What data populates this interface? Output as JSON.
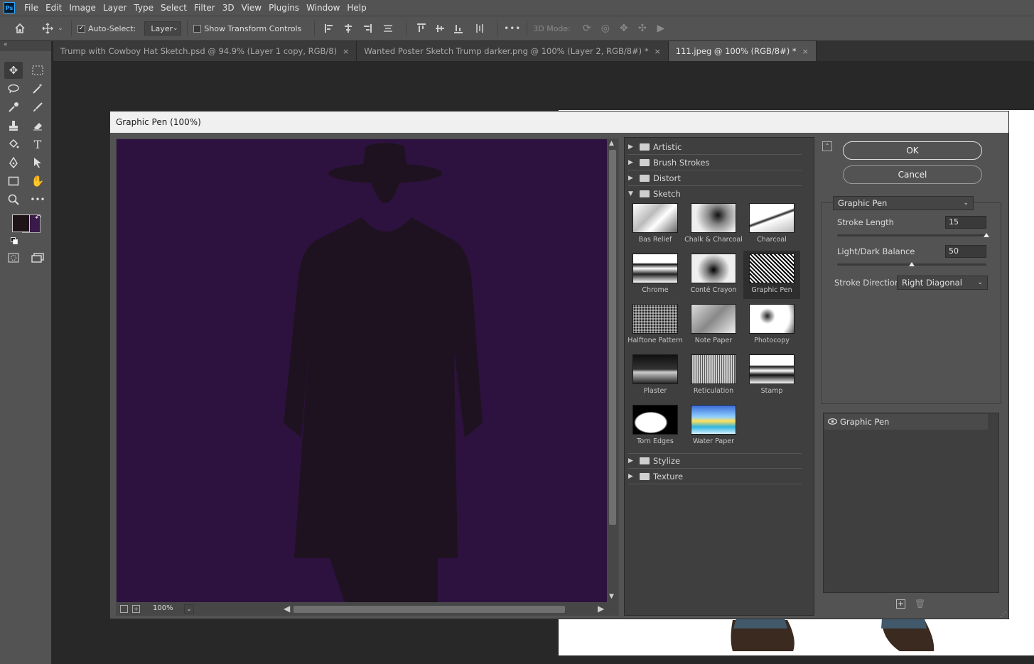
{
  "menu": [
    "File",
    "Edit",
    "Image",
    "Layer",
    "Type",
    "Select",
    "Filter",
    "3D",
    "View",
    "Plugins",
    "Window",
    "Help"
  ],
  "app_logo": "Ps",
  "options_bar": {
    "auto_select_label": "Auto-Select:",
    "auto_select_value": "Layer",
    "show_transform_label": "Show Transform Controls",
    "mode_3d_label": "3D Mode:",
    "more_label": "•••"
  },
  "tabs": [
    {
      "label": "Trump with Cowboy Hat Sketch.psd @ 94.9% (Layer 1 copy, RGB/8)",
      "active": false
    },
    {
      "label": "Wanted Poster Sketch Trump darker.png @ 100% (Layer 2, RGB/8#) *",
      "active": false
    },
    {
      "label": "111.jpeg @ 100% (RGB/8#) *",
      "active": true
    }
  ],
  "toolbar_collapse": "«",
  "colors": {
    "foreground": "#1e1418",
    "background": "#3a1a4a",
    "preview_bg": "#2d1240",
    "silhouette": "#1f1220"
  },
  "dialog": {
    "title": "Graphic Pen (100%)",
    "zoom": "100%",
    "ok_label": "OK",
    "cancel_label": "Cancel",
    "filter_select": "Graphic Pen",
    "stroke_length_label": "Stroke Length",
    "stroke_length_value": "15",
    "stroke_length_fraction": 1.0,
    "light_dark_label": "Light/Dark Balance",
    "light_dark_value": "50",
    "light_dark_fraction": 0.5,
    "stroke_direction_label": "Stroke Direction:",
    "stroke_direction_value": "Right Diagonal",
    "effect_layer": "Graphic Pen"
  },
  "gallery": {
    "categories_top": [
      "Artistic",
      "Brush Strokes",
      "Distort"
    ],
    "open_category": "Sketch",
    "categories_bottom": [
      "Stylize",
      "Texture"
    ],
    "filters": [
      {
        "label": "Bas Relief",
        "selected": false
      },
      {
        "label": "Chalk & Charcoal",
        "selected": false
      },
      {
        "label": "Charcoal",
        "selected": false
      },
      {
        "label": "Chrome",
        "selected": false
      },
      {
        "label": "Conté Crayon",
        "selected": false
      },
      {
        "label": "Graphic Pen",
        "selected": true
      },
      {
        "label": "Halftone Pattern",
        "selected": false
      },
      {
        "label": "Note Paper",
        "selected": false
      },
      {
        "label": "Photocopy",
        "selected": false
      },
      {
        "label": "Plaster",
        "selected": false
      },
      {
        "label": "Reticulation",
        "selected": false
      },
      {
        "label": "Stamp",
        "selected": false
      },
      {
        "label": "Torn Edges",
        "selected": false
      },
      {
        "label": "Water Paper",
        "selected": false
      }
    ]
  }
}
